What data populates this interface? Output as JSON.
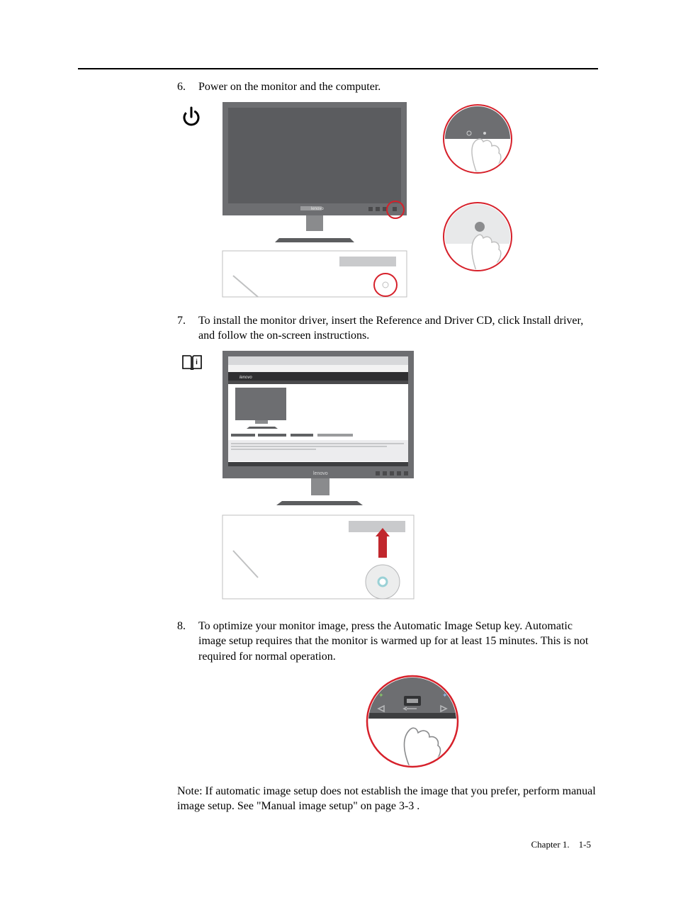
{
  "steps": {
    "s6": {
      "num": "6.",
      "text": "Power on the monitor and the computer."
    },
    "s7": {
      "num": "7.",
      "text": "To install the monitor driver, insert the Reference and Driver CD, click Install driver, and follow the on-screen instructions."
    },
    "s8": {
      "num": "8.",
      "text": "To optimize your monitor image, press the Automatic Image Setup key.  Automatic image setup requires that the monitor is warmed up for at least 15 minutes. This is not required for normal operation."
    }
  },
  "note": "Note:  If automatic image setup does not establish the image that you prefer, perform manual image setup. See \"Manual image setup\" on page 3-3 .",
  "footer": {
    "label": "Chapter 1.",
    "page": "1-5"
  },
  "illustrations": {
    "brand": "lenovo",
    "fig6_margin": "power-icon",
    "fig7_margin": "manual-icon",
    "fig8_label": "auto-image-setup-key"
  },
  "colors": {
    "accent": "#d6202a",
    "monitor_bezel": "#6d6e71",
    "monitor_screen": "#5b5c5f",
    "desk": "#c9cacc",
    "arrow": "#c1272d"
  }
}
